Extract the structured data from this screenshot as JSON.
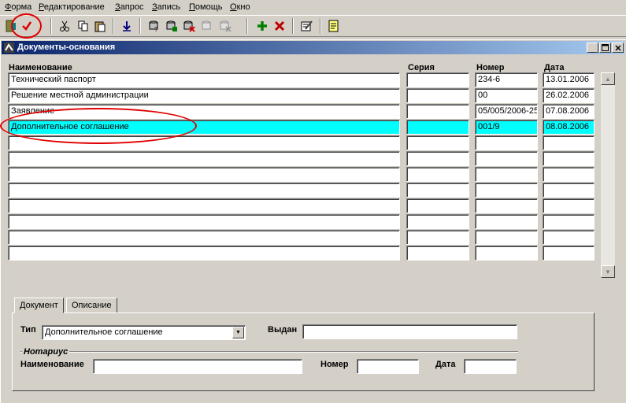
{
  "menu": [
    "Форма",
    "Редактирование",
    "Запрос",
    "Запись",
    "Помощь",
    "Окно"
  ],
  "toolbar_icons": [
    "exit-icon",
    "commit-checkmark-icon",
    "cut-icon",
    "copy-icon",
    "paste-icon",
    "download-icon",
    "query-enter-icon",
    "query-execute-icon",
    "query-cancel-icon",
    "query-count-icon",
    "query-fetch-icon",
    "insert-record-icon",
    "delete-record-icon",
    "edit-icon",
    "help-icon"
  ],
  "window": {
    "title": "Документы-основания"
  },
  "grid": {
    "headers": {
      "name": "Наименование",
      "series": "Серия",
      "number": "Номер",
      "date": "Дата"
    },
    "rows": [
      {
        "name": "Технический паспорт",
        "series": "",
        "number": "234-6",
        "date": "13.01.2006"
      },
      {
        "name": "Решение местной администрации",
        "series": "",
        "number": "00",
        "date": "26.02.2006"
      },
      {
        "name": "Заявление",
        "series": "",
        "number": "05/005/2006-25",
        "date": "07.08.2006"
      },
      {
        "name": "Дополнительное соглашение",
        "series": "",
        "number": "001/9",
        "date": "08.08.2006",
        "selected": true
      },
      {
        "name": "",
        "series": "",
        "number": "",
        "date": ""
      },
      {
        "name": "",
        "series": "",
        "number": "",
        "date": ""
      },
      {
        "name": "",
        "series": "",
        "number": "",
        "date": ""
      },
      {
        "name": "",
        "series": "",
        "number": "",
        "date": ""
      },
      {
        "name": "",
        "series": "",
        "number": "",
        "date": ""
      },
      {
        "name": "",
        "series": "",
        "number": "",
        "date": ""
      },
      {
        "name": "",
        "series": "",
        "number": "",
        "date": ""
      },
      {
        "name": "",
        "series": "",
        "number": "",
        "date": ""
      }
    ]
  },
  "tabs": [
    {
      "label": "Документ",
      "active": true
    },
    {
      "label": "Описание",
      "active": false
    }
  ],
  "detail": {
    "type_label": "Тип",
    "type_value": "Дополнительное соглашение",
    "issued_label": "Выдан",
    "issued_value": "",
    "notary_label": "Нотариус",
    "notary_name_label": "Наименование",
    "notary_name_value": "",
    "notary_number_label": "Номер",
    "notary_number_value": "",
    "notary_date_label": "Дата",
    "notary_date_value": ""
  },
  "colors": {
    "selected_row": "#00ffff",
    "title_start": "#0a246a",
    "title_end": "#a6caf0",
    "annotation": "#e00000"
  }
}
